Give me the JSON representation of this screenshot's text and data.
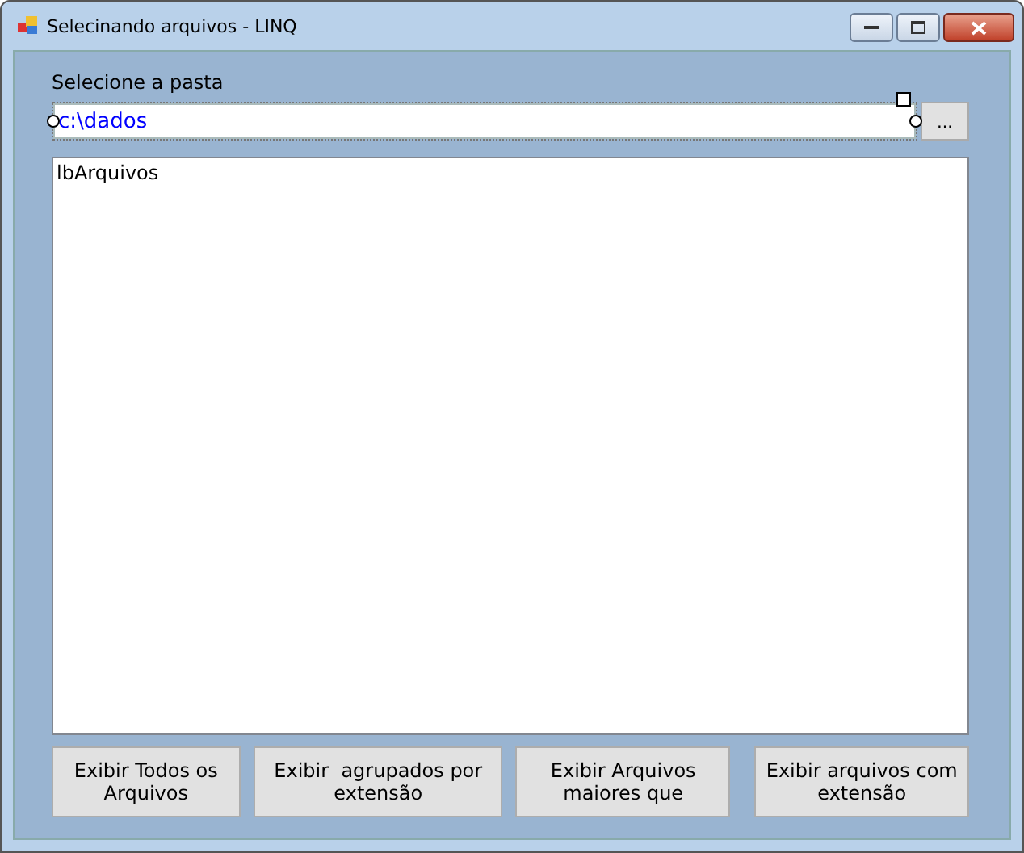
{
  "window": {
    "title": "Selecinando arquivos - LINQ"
  },
  "folder_label": "Selecione a pasta",
  "folder_field": {
    "value": "c:\\dados"
  },
  "browse_button": "...",
  "list": {
    "items": [
      "lbArquivos"
    ]
  },
  "buttons": [
    "Exibir Todos os Arquivos",
    "Exibir  agrupados por extensão",
    "Exibir Arquivos maiores que",
    "Exibir arquivos com extensão"
  ]
}
